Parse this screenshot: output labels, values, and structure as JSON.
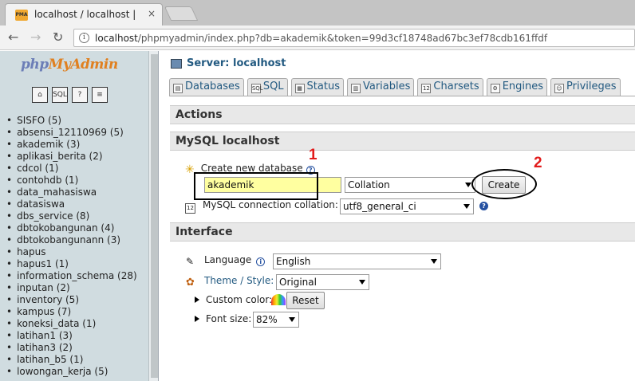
{
  "browser": {
    "tab_title": "localhost / localhost | php",
    "tab_close": "×",
    "favicon_label": "PMA",
    "url_host": "localhost",
    "url_path": "/phpmyadmin/index.php?db=akademik&token=99d3cf18748ad67bc3ef78cdb161ffdf"
  },
  "sidebar": {
    "logo_php": "php",
    "logo_myadmin": "MyAdmin",
    "icons": [
      "home-icon",
      "sql-icon",
      "help-icon",
      "query-icon"
    ],
    "databases": [
      "SISFO (5)",
      "absensi_12110969 (5)",
      "akademik (3)",
      "aplikasi_berita (2)",
      "cdcol (1)",
      "contohdb (1)",
      "data_mahasiswa",
      "datasiswa",
      "dbs_service (8)",
      "dbtokobangunan (4)",
      "dbtokobangunann (3)",
      "hapus",
      "hapus1 (1)",
      "information_schema (28)",
      "inputan (2)",
      "inventory (5)",
      "kampus (7)",
      "koneksi_data (1)",
      "latihan1 (3)",
      "latihan3 (2)",
      "latihan_b5 (1)",
      "lowongan_kerja (5)"
    ]
  },
  "main": {
    "server_label": "Server: localhost",
    "tabs": [
      {
        "label": "Databases",
        "icon": "databases-icon"
      },
      {
        "label": "SQL",
        "icon": "sql-icon"
      },
      {
        "label": "Status",
        "icon": "status-icon"
      },
      {
        "label": "Variables",
        "icon": "variables-icon"
      },
      {
        "label": "Charsets",
        "icon": "charsets-icon"
      },
      {
        "label": "Engines",
        "icon": "engines-icon"
      },
      {
        "label": "Privileges",
        "icon": "privileges-icon"
      }
    ],
    "actions_heading": "Actions",
    "mysql_heading": "MySQL localhost",
    "create_db_label": "Create new database",
    "create_db_value": "akademik",
    "collation_placeholder": "Collation",
    "create_button": "Create",
    "connection_collation_label": "MySQL connection collation:",
    "connection_collation_value": "utf8_general_ci",
    "interface_heading": "Interface",
    "language_label": "Language",
    "language_value": "English",
    "theme_label": "Theme / Style:",
    "theme_value": "Original",
    "custom_color_label": "Custom color:",
    "reset_button": "Reset",
    "font_size_label": "Font size:",
    "font_size_value": "82%"
  },
  "annotations": {
    "marker_1": "1",
    "marker_2": "2",
    "color": "#e21b1b"
  },
  "colors": {
    "link_blue": "#235a81",
    "sidebar_bg": "#d0dce0",
    "highlight_input": "#ffffa0"
  }
}
